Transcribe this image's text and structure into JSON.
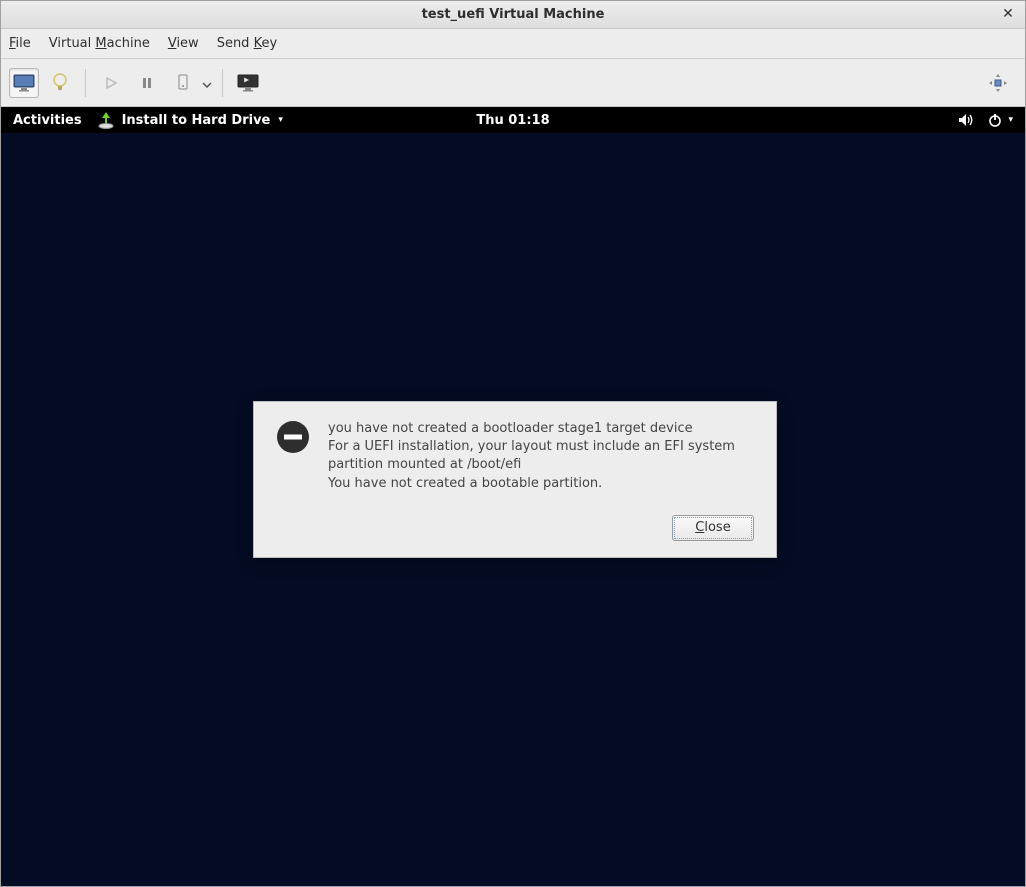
{
  "window": {
    "title": "test_uefi Virtual Machine"
  },
  "menubar": {
    "file": "File",
    "virtual_machine": "Virtual Machine",
    "view": "View",
    "send_key": "Send Key"
  },
  "gnome": {
    "activities": "Activities",
    "app_title": "Install to Hard Drive",
    "clock": "Thu 01:18"
  },
  "dialog": {
    "line1": "you have not created a bootloader stage1 target device",
    "line2": "For a UEFI installation, your layout must include an EFI system partition mounted at /boot/efi",
    "line3": "You have not created a bootable partition.",
    "close_label": "Close"
  }
}
